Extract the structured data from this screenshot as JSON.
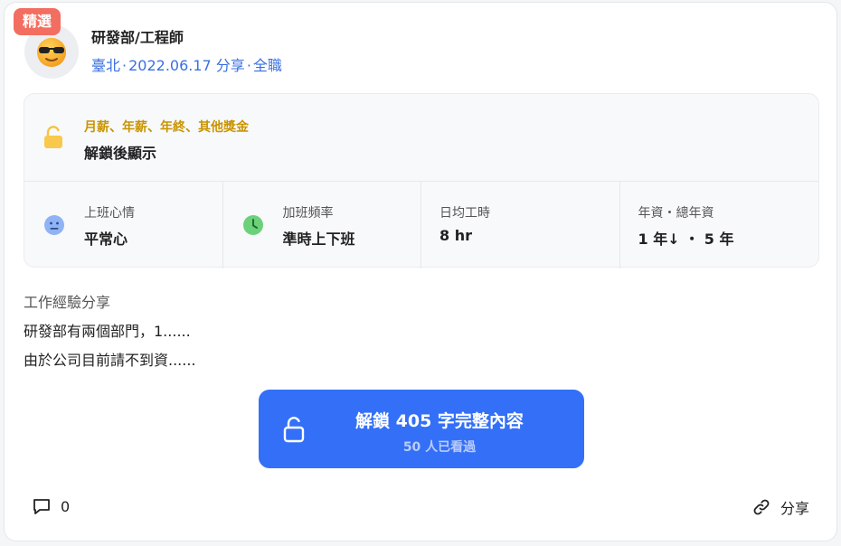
{
  "badge": "精選",
  "post": {
    "title": "研發部/工程師",
    "location": "臺北",
    "date": "2022.06.17 分享",
    "job_type": "全職"
  },
  "salary": {
    "label": "月薪、年薪、年終、其他獎金",
    "value": "解鎖後顯示"
  },
  "stats": [
    {
      "label": "上班心情",
      "value": "平常心",
      "icon": "neutral-face-icon"
    },
    {
      "label": "加班頻率",
      "value": "準時上下班",
      "icon": "clock-icon"
    },
    {
      "label": "日均工時",
      "value": "8 hr"
    },
    {
      "label": "年資・總年資",
      "value": "1 年↓ ・ 5 年"
    }
  ],
  "experience": {
    "title": "工作經驗分享",
    "lines": [
      "研發部有兩個部門，1......",
      "由於公司目前請不到資......"
    ]
  },
  "unlock": {
    "label": "解鎖 405 字完整內容",
    "sub": "50 人已看過"
  },
  "footer": {
    "comment_count": "0",
    "share_label": "分享"
  },
  "colors": {
    "accent": "#3470f7",
    "badge": "#f26e61",
    "salary_label": "#c99400",
    "meta": "#3a6fe0"
  }
}
